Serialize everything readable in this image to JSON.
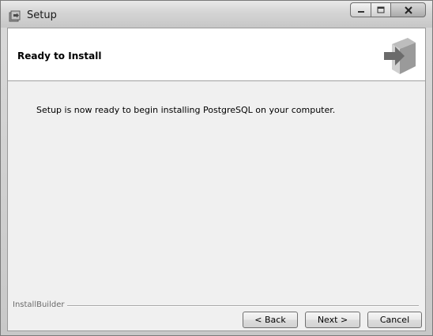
{
  "window": {
    "title": "Setup",
    "minimize_icon": "minimize-icon",
    "maximize_icon": "maximize-icon",
    "close_icon": "close-icon"
  },
  "header": {
    "title": "Ready to Install",
    "graphic_icon": "install-box-arrow-icon"
  },
  "body": {
    "message": "Setup is now ready to begin installing PostgreSQL on your computer."
  },
  "footer": {
    "brand": "InstallBuilder",
    "back_label": "< Back",
    "next_label": "Next >",
    "cancel_label": "Cancel"
  },
  "colors": {
    "client_background": "#f0f0f0",
    "header_background": "#ffffff",
    "titlebar": "#d4d4d4"
  }
}
